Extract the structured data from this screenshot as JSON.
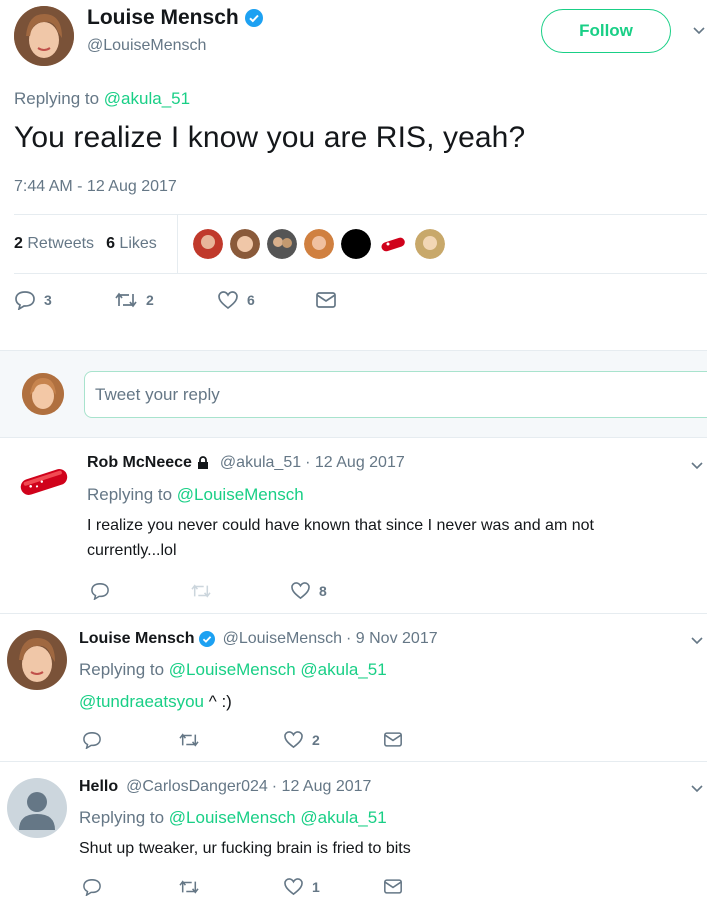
{
  "main_tweet": {
    "name": "Louise Mensch",
    "handle": "@LouiseMensch",
    "follow_label": "Follow",
    "replying_prefix": "Replying to",
    "replying_to": "@akula_51",
    "text": "You realize I know you are RIS, yeah?",
    "timestamp": "7:44 AM - 12 Aug 2017",
    "retweets_count": "2",
    "retweets_label": "Retweets",
    "likes_count": "6",
    "likes_label": "Likes",
    "reply_count": "3",
    "retweet_action_count": "2",
    "like_action_count": "6"
  },
  "reply_input": {
    "placeholder": "Tweet your reply"
  },
  "replies": [
    {
      "name": "Rob McNeece",
      "handle": "@akula_51",
      "date": "· 12 Aug 2017",
      "replying_prefix": "Replying to",
      "replying_to": "@LouiseMensch",
      "text": "I realize you never could have known that since I never was and am not currently...lol",
      "like_count": "8"
    },
    {
      "name": "Louise Mensch",
      "handle": "@LouiseMensch",
      "date": "· 9 Nov 2017",
      "replying_prefix": "Replying to",
      "replying_to": "@LouiseMensch @akula_51",
      "mention": "@tundraeatsyou",
      "text": " ^ :)",
      "like_count": "2"
    },
    {
      "name": "Hello",
      "handle": "@CarlosDanger024",
      "date": "· 12 Aug 2017",
      "replying_prefix": "Replying to",
      "replying_to": "@LouiseMensch @akula_51",
      "text": "Shut up tweaker, ur fucking brain is fried to bits",
      "like_count": "1"
    }
  ],
  "colors": {
    "accent": "#19cf86",
    "verified": "#1da1f2",
    "muted": "#657786"
  }
}
